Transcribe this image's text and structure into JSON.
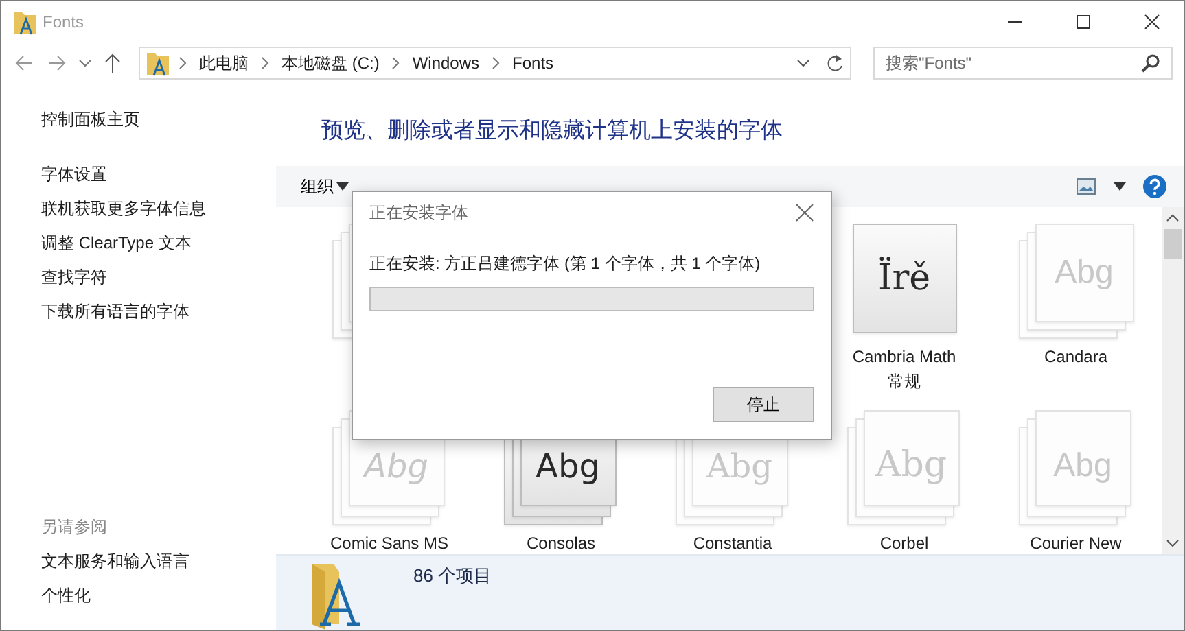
{
  "window": {
    "title": "Fonts"
  },
  "address": {
    "crumbs": [
      "此电脑",
      "本地磁盘 (C:)",
      "Windows",
      "Fonts"
    ]
  },
  "search": {
    "placeholder": "搜索\"Fonts\""
  },
  "sidebar": {
    "home": "控制面板主页",
    "links": [
      "字体设置",
      "联机获取更多字体信息",
      "调整 ClearType 文本",
      "查找字符",
      "下载所有语言的字体"
    ],
    "see_also": "另请参阅",
    "see_also_links": [
      "文本服务和输入语言",
      "个性化"
    ]
  },
  "heading": "预览、删除或者显示和隐藏计算机上安装的字体",
  "toolbar": {
    "organize": "组织"
  },
  "fonts": [
    {
      "hidden": true,
      "kind": "family"
    },
    {
      "kind": "blank"
    },
    {
      "kind": "blank"
    },
    {
      "preview": "Ïrě",
      "name": "Cambria Math",
      "style": "常规",
      "hidden": false,
      "kind": "single"
    },
    {
      "preview": "Abg",
      "name": "Candara",
      "hidden": true,
      "kind": "family"
    },
    {
      "preview": "Abg",
      "name": "Comic Sans MS",
      "hidden": true,
      "kind": "family"
    },
    {
      "preview": "Abg",
      "name": "Consolas",
      "hidden": false,
      "kind": "family"
    },
    {
      "preview": "Abg",
      "name": "Constantia",
      "hidden": true,
      "kind": "family"
    },
    {
      "preview": "Abg",
      "name": "Corbel",
      "hidden": true,
      "kind": "family"
    },
    {
      "preview": "Abg",
      "name": "Courier New",
      "hidden": true,
      "kind": "family"
    }
  ],
  "status_bar": {
    "count": "86 个项目"
  },
  "dialog": {
    "title": "正在安装字体",
    "message": "正在安装: 方正吕建德字体 (第 1 个字体，共 1 个字体)",
    "level": 0,
    "button": "停止"
  }
}
